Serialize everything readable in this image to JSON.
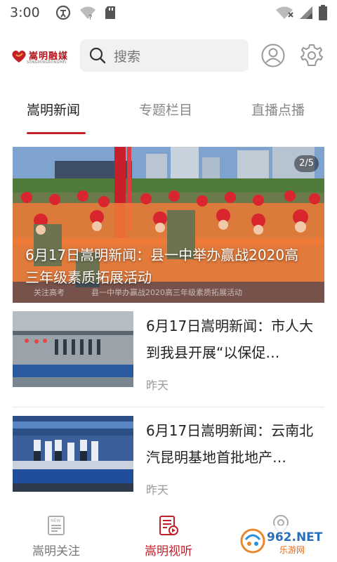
{
  "status_bar": {
    "time": "3:00",
    "left_icons": [
      "accessibility-icon",
      "wifi-unknown-icon",
      "sd-card-icon"
    ],
    "right_icons": [
      "wifi-icon",
      "cell-signal-icon",
      "battery-icon"
    ]
  },
  "header": {
    "logo_text": "嵩明融媒",
    "logo_subtext": "SONGMINGRONGMEI",
    "search_placeholder": "搜索",
    "search_icon": "search-icon",
    "avatar_icon": "user-avatar-icon",
    "settings_icon": "gear-icon"
  },
  "tabs": [
    {
      "label": "嵩明新闻",
      "active": true
    },
    {
      "label": "专题栏目",
      "active": false
    },
    {
      "label": "直播点播",
      "active": false
    }
  ],
  "banner": {
    "counter": "2/5",
    "title": "6月17日嵩明新闻：县一中举办赢战2020高三年级素质拓展活动",
    "strip_tag": "关注高考",
    "strip_text": "县一中举办赢战2020高三年级素质拓展活动"
  },
  "news": [
    {
      "title": "6月17日嵩明新闻：市人大到我县开展“以保促…",
      "time": "昨天"
    },
    {
      "title": "6月17日嵩明新闻：云南北汽昆明基地首批地产…",
      "time": "昨天"
    }
  ],
  "bottom_nav": [
    {
      "label": "嵩明关注",
      "icon": "newspaper-icon",
      "active": false
    },
    {
      "label": "嵩明视听",
      "icon": "video-list-icon",
      "active": true
    },
    {
      "label": "",
      "icon": "location-pin-icon",
      "active": false
    }
  ],
  "watermark": {
    "text": "962.NET",
    "subtext": "乐游网"
  },
  "colors": {
    "accent": "#c21f28",
    "inactive": "#888888",
    "search_bg": "#f1f1f1"
  }
}
